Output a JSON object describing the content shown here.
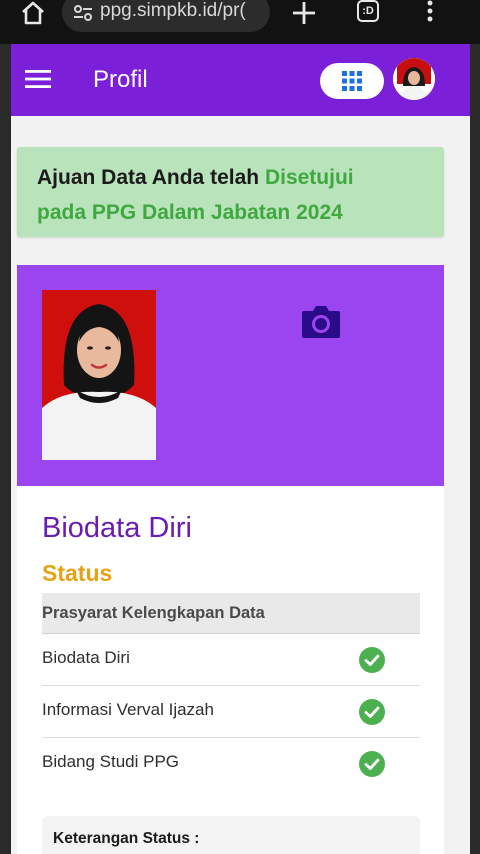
{
  "browser": {
    "url": "ppg.simpkb.id/pr(",
    "tab_label": ":D"
  },
  "app_bar": {
    "title": "Profil",
    "accent_color": "#7b1fd8"
  },
  "banner": {
    "text_dark": "Ajuan Data Anda telah ",
    "text_green_1": "Disetujui",
    "text_green_2": "pada PPG Dalam Jabatan 2024",
    "color_green": "#3fa83f"
  },
  "biodata": {
    "title": "Biodata Diri",
    "status_title": "Status",
    "requirements_header": "Prasyarat Kelengkapan Data",
    "requirements": [
      {
        "label": "Biodata Diri",
        "status_icon": "check-circle-icon"
      },
      {
        "label": "Informasi Verval Ijazah",
        "status_icon": "check-circle-icon"
      },
      {
        "label": "Bidang Studi PPG",
        "status_icon": "check-circle-icon"
      }
    ],
    "note_label": "Keterangan Status :"
  },
  "colors": {
    "photo_card": "#9b45f0",
    "status": "#e6a216",
    "check": "#4caf50"
  }
}
